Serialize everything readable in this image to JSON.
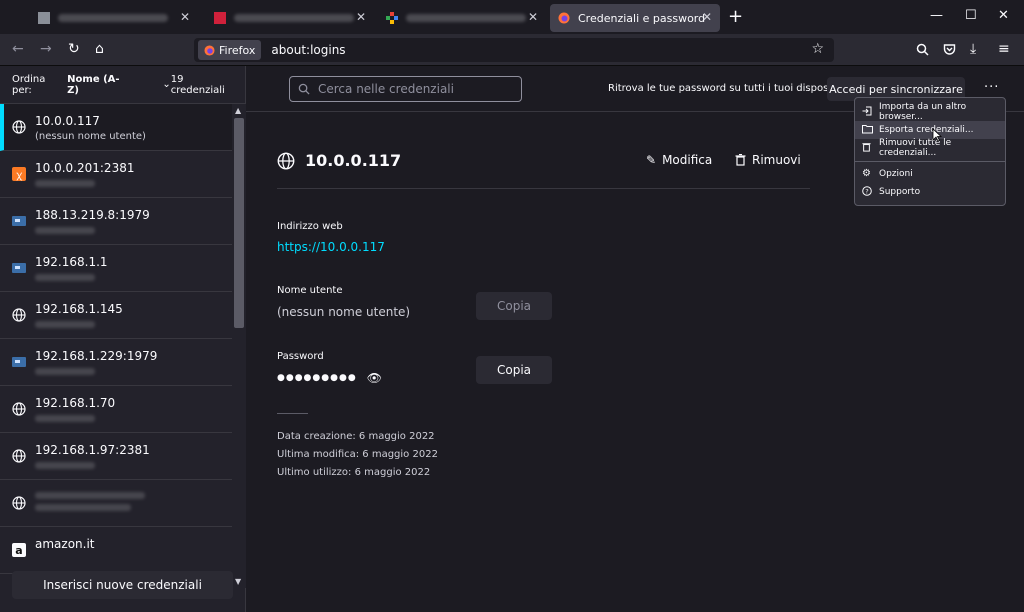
{
  "tabs": [
    {
      "label": "",
      "blurred": true
    },
    {
      "label": "",
      "blurred": true
    },
    {
      "label": "",
      "blurred": true
    },
    {
      "label": "Credenziali e password",
      "blurred": false,
      "active": true
    }
  ],
  "toolbar": {
    "identity_label": "Firefox",
    "url": "about:logins"
  },
  "sidebar": {
    "sort_label": "Ordina per:",
    "sort_value": "Nome (A-Z)",
    "count": "19 credenziali",
    "items": [
      {
        "title": "10.0.0.117",
        "sub": "(nessun nome utente)",
        "icon": "globe-icon",
        "active": true
      },
      {
        "title": "10.0.0.201:2381",
        "sub": "",
        "icon": "xampp-icon"
      },
      {
        "title": "188.13.219.8:1979",
        "sub": "",
        "icon": "router-icon"
      },
      {
        "title": "192.168.1.1",
        "sub": "",
        "icon": "router-icon"
      },
      {
        "title": "192.168.1.145",
        "sub": "",
        "icon": "globe-icon"
      },
      {
        "title": "192.168.1.229:1979",
        "sub": "",
        "icon": "router-icon"
      },
      {
        "title": "192.168.1.70",
        "sub": "",
        "icon": "globe-icon"
      },
      {
        "title": "192.168.1.97:2381",
        "sub": "",
        "icon": "globe-icon"
      },
      {
        "title": "",
        "sub": "",
        "icon": "globe-icon"
      },
      {
        "title": "amazon.it",
        "sub": "",
        "icon": "amazon-icon"
      }
    ],
    "add_button": "Inserisci nuove credenziali"
  },
  "header": {
    "search_placeholder": "Cerca nelle credenziali",
    "sync_text": "Ritrova le tue password su tutti i tuoi dispositivi",
    "sync_button": "Accedi per sincronizzare"
  },
  "detail": {
    "title": "10.0.0.117",
    "edit_label": "Modifica",
    "remove_label": "Rimuovi",
    "web_address_label": "Indirizzo web",
    "web_address": "https://10.0.0.117",
    "username_label": "Nome utente",
    "username_value": "(nessun nome utente)",
    "copy_label": "Copia",
    "password_label": "Password",
    "password_mask": "●●●●●●●●●",
    "created": "Data creazione: 6 maggio 2022",
    "modified": "Ultima modifica: 6 maggio 2022",
    "last_used": "Ultimo utilizzo: 6 maggio 2022"
  },
  "menu": {
    "items": [
      {
        "label": "Importa da un altro browser...",
        "icon": "import-icon"
      },
      {
        "label": "Esporta credenziali...",
        "icon": "export-folder-icon",
        "highlighted": true
      },
      {
        "label": "Rimuovi tutte le credenziali...",
        "icon": "trash-icon"
      },
      {
        "label": "Opzioni",
        "icon": "gear-icon"
      },
      {
        "label": "Supporto",
        "icon": "help-icon"
      }
    ]
  },
  "colors": {
    "accent": "#00ddff",
    "background": "#1c1b22",
    "panel": "#2b2a33"
  }
}
